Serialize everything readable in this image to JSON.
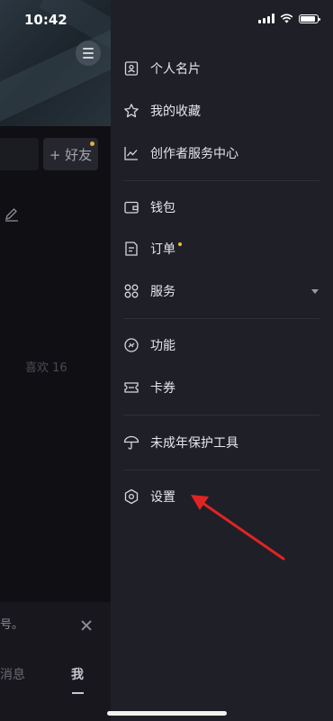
{
  "status": {
    "time": "10:42",
    "battery_level": 0.9
  },
  "profile_bg": {
    "friend_button": "+ 好友",
    "likes": "喜欢 16",
    "tip": "号。",
    "tabs": {
      "messages": "消息",
      "me": "我"
    }
  },
  "drawer": {
    "items": [
      {
        "label": "个人名片",
        "icon": "id-card-icon"
      },
      {
        "label": "我的收藏",
        "icon": "star-icon"
      },
      {
        "label": "创作者服务中心",
        "icon": "chart-icon"
      },
      {
        "label": "钱包",
        "icon": "wallet-icon"
      },
      {
        "label": "订单",
        "icon": "order-icon",
        "badge": true
      },
      {
        "label": "服务",
        "icon": "grid-icon",
        "expandable": true
      },
      {
        "label": "功能",
        "icon": "link-icon"
      },
      {
        "label": "卡券",
        "icon": "ticket-icon"
      },
      {
        "label": "未成年保护工具",
        "icon": "umbrella-icon"
      },
      {
        "label": "设置",
        "icon": "gear-icon"
      }
    ]
  },
  "annotation": {
    "arrow_color": "#e02424"
  }
}
